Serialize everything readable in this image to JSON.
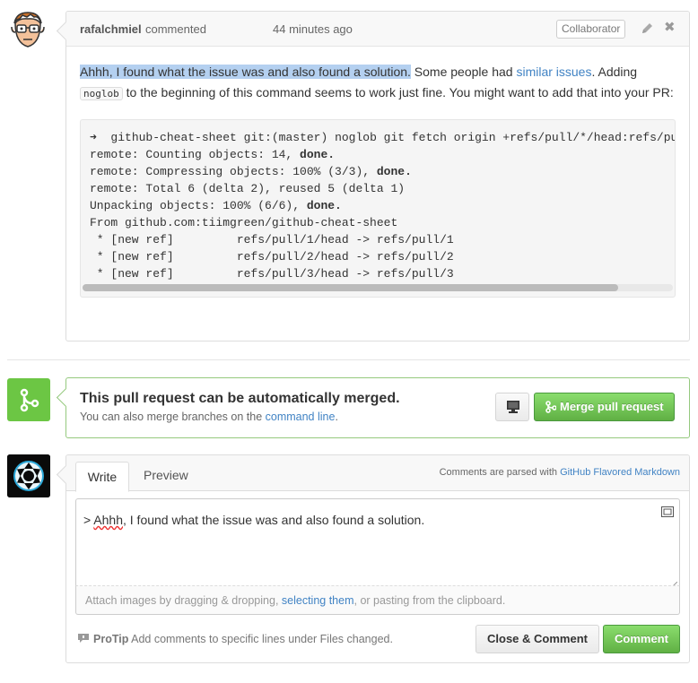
{
  "comment": {
    "author": "rafalchmiel",
    "action": "commented",
    "time": "44 minutes ago",
    "badge": "Collaborator",
    "body": {
      "selected": "Ahhh, I found what the issue was and also found a solution.",
      "text1": " Some people had ",
      "link": "similar issues",
      "text2": ". Adding ",
      "code": "noglob",
      "text3": " to the beginning of this command seems to work just fine. You might want to add that into your PR:"
    },
    "code_lines": [
      {
        "pre": "➜  github-cheat-sheet git:(master) noglob git fetch origin +refs/pull/*/head:refs/pull/*",
        "bold": "",
        "post": ""
      },
      {
        "pre": "remote: Counting objects: 14, ",
        "bold": "done.",
        "post": ""
      },
      {
        "pre": "remote: Compressing objects: 100% (3/3), ",
        "bold": "done.",
        "post": ""
      },
      {
        "pre": "remote: Total 6 (delta 2), reused 5 (delta 1)",
        "bold": "",
        "post": ""
      },
      {
        "pre": "Unpacking objects: 100% (6/6), ",
        "bold": "done.",
        "post": ""
      },
      {
        "pre": "From github.com:tiimgreen/github-cheat-sheet",
        "bold": "",
        "post": ""
      },
      {
        "pre": " * [new ref]         refs/pull/1/head -> refs/pull/1",
        "bold": "",
        "post": ""
      },
      {
        "pre": " * [new ref]         refs/pull/2/head -> refs/pull/2",
        "bold": "",
        "post": ""
      },
      {
        "pre": " * [new ref]         refs/pull/3/head -> refs/pull/3",
        "bold": "",
        "post": ""
      }
    ]
  },
  "merge": {
    "title": "This pull request can be automatically merged.",
    "sub_text": "You can also merge branches on the ",
    "sub_link": "command line",
    "sub_end": ".",
    "button": "Merge pull request"
  },
  "reply": {
    "tab_write": "Write",
    "tab_preview": "Preview",
    "md_note": "Comments are parsed with ",
    "md_link": "GitHub Flavored Markdown",
    "textarea_prefix": "> ",
    "textarea_misspelled": "Ahhh",
    "textarea_rest": ", I found what the issue was and also found a solution.",
    "attach_text1": "Attach images by dragging & dropping, ",
    "attach_link": "selecting them",
    "attach_text2": ", or pasting from the clipboard.",
    "protip_label": "ProTip",
    "protip_text": " Add comments to specific lines under Files changed.",
    "close_comment_button": "Close & Comment",
    "comment_button": "Comment"
  },
  "colors": {
    "green": "#6cc644",
    "link": "#4183c4",
    "selection": "#b4d0f0"
  },
  "icons": {
    "edit": "pencil-icon",
    "close": "close-icon",
    "merge": "git-merge-icon",
    "desktop": "desktop-icon",
    "fullscreen": "fullscreen-icon",
    "protip": "comment-tip-icon"
  }
}
